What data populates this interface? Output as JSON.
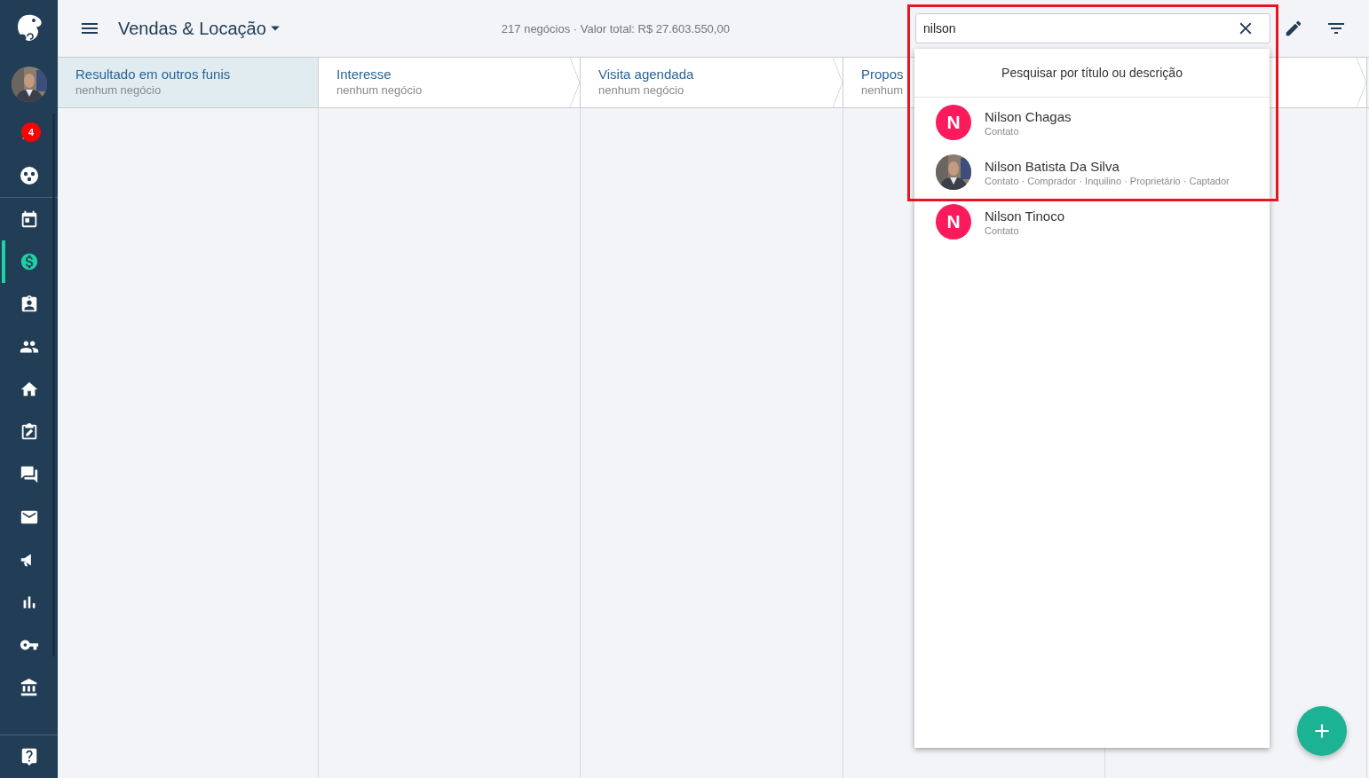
{
  "sidebar": {
    "notifications": {
      "count": "4"
    },
    "nav_items": [
      {
        "selected": false
      },
      {
        "selected": true
      },
      {
        "selected": false
      },
      {
        "selected": false
      },
      {
        "selected": false
      },
      {
        "selected": false
      },
      {
        "selected": false
      },
      {
        "selected": false
      },
      {
        "selected": false
      },
      {
        "selected": false
      },
      {
        "selected": false
      },
      {
        "selected": false
      }
    ]
  },
  "header": {
    "title": "Vendas & Locação",
    "summary": "217 negócios · Valor total: R$ 27.603.550,00"
  },
  "search": {
    "value": "nilson",
    "hint": "Pesquisar por título ou descrição",
    "results": [
      {
        "name": "Nilson Chagas",
        "roles": "Contato",
        "avatar": {
          "kind": "letter",
          "letter": "N"
        }
      },
      {
        "name": "Nilson Batista Da Silva",
        "roles": "Contato · Comprador · Inquilino · Proprietário · Captador"
      },
      {
        "name": "Nilson Tinoco",
        "roles": "Contato",
        "avatar": {
          "kind": "letter",
          "letter": "N"
        }
      }
    ]
  },
  "stages": [
    {
      "title": "Resultado em outros funis",
      "subtitle": "nenhum negócio",
      "selected": true
    },
    {
      "title": "Interesse",
      "subtitle": "nenhum negócio",
      "selected": false
    },
    {
      "title": "Visita agendada",
      "subtitle": "nenhum negócio",
      "selected": false
    },
    {
      "title": "Propos",
      "subtitle": "nenhum",
      "selected": false
    },
    {
      "selected": false
    }
  ]
}
